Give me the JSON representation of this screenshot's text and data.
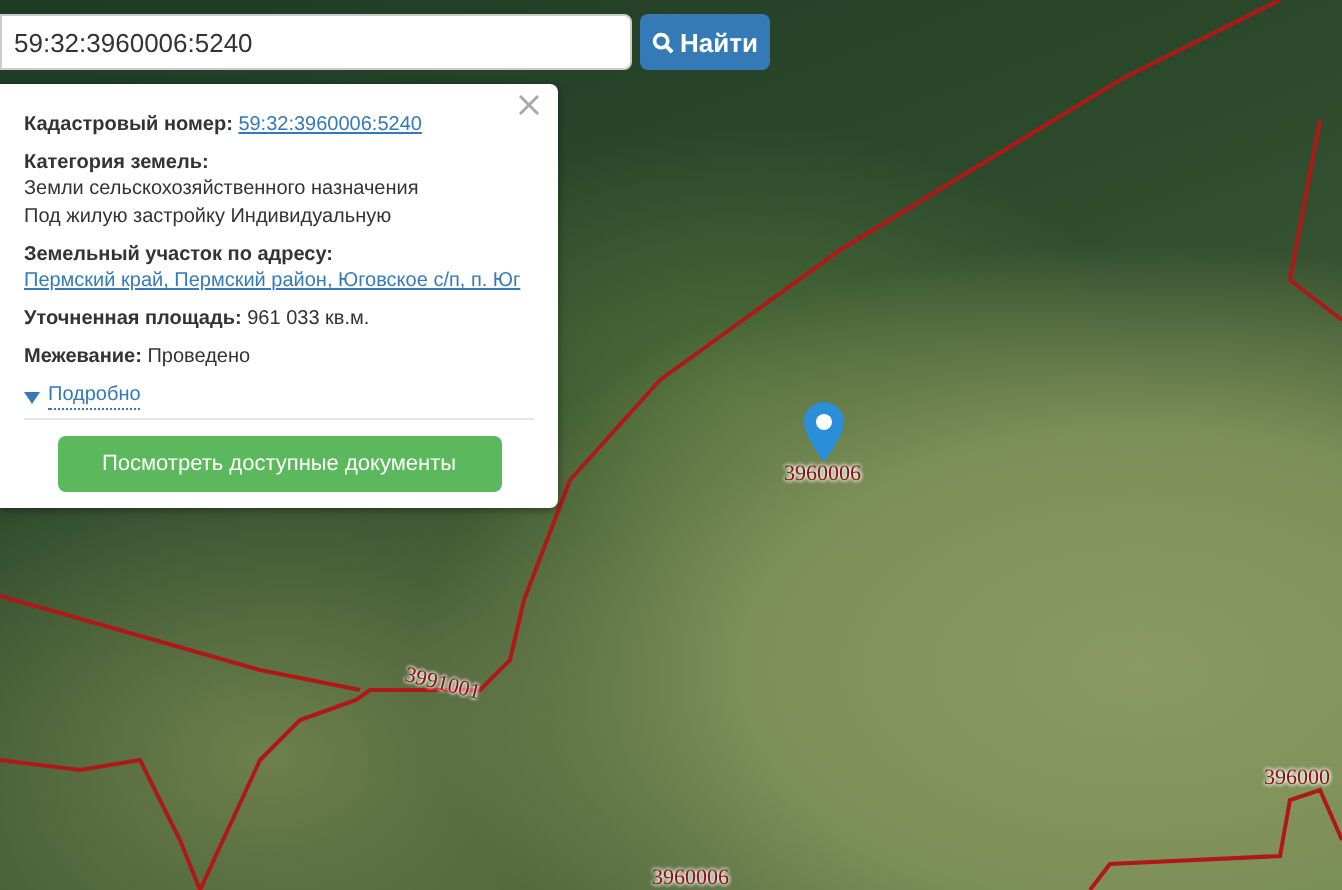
{
  "search": {
    "value": "59:32:3960006:5240",
    "button": "Найти"
  },
  "popup": {
    "fields": [
      {
        "kind": "link",
        "label": "Кадастровый номер:",
        "value": "59:32:3960006:5240"
      },
      {
        "kind": "text",
        "label": "Категория земель:",
        "value": "Земли сельскохозяйственного назначения"
      },
      {
        "kind": "note",
        "value": "Под жилую застройку Индивидуальную"
      },
      {
        "kind": "link",
        "label": "Земельный участок по адресу:",
        "value": "Пермский край, Пермский район, Юговское с/п, п. Юг"
      },
      {
        "kind": "text",
        "label": "Уточненная площадь:",
        "value": "961 033 кв.м."
      },
      {
        "kind": "text",
        "label": "Межевание:",
        "value": "Проведено"
      }
    ],
    "details": {
      "label": "Подробно",
      "expanded": false
    },
    "button": "Посмотреть доступные документы"
  },
  "map": {
    "labels": [
      "3960006",
      "3991001",
      "396000",
      "3960006"
    ]
  }
}
